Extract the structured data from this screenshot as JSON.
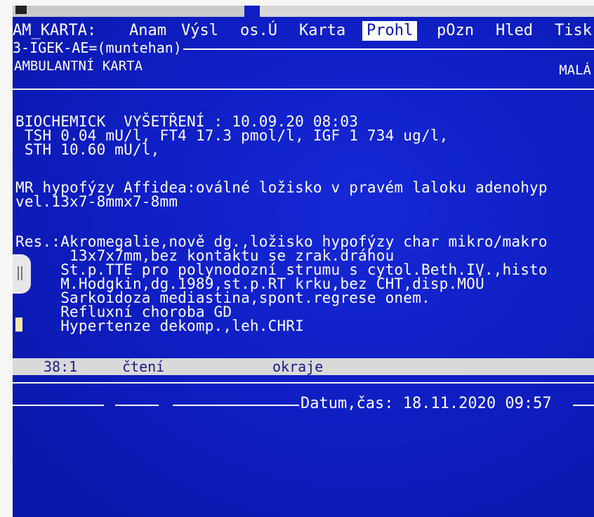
{
  "menu": {
    "app_label": "AM_KARTA:",
    "items": [
      {
        "label": "Anam"
      },
      {
        "label": "Výsl"
      },
      {
        "label": "os.Ú"
      },
      {
        "label": "Karta"
      },
      {
        "label": "Prohl",
        "active": true
      },
      {
        "label": "pOzn"
      },
      {
        "label": "Hled"
      },
      {
        "label": "Tisk"
      }
    ]
  },
  "patient_line": "3-IGEK-AE=(muntehan)",
  "header": {
    "title": "AMBULANTNÍ KARTA",
    "right_label": "MALÁ"
  },
  "content": {
    "lines": [
      "BIOCHEMICK  VYŠETŘENÍ : 10.09.20 08:03",
      " TSH 0.04 mU/l, FT4 17.3 pmol/l, IGF 1 734 ug/l,",
      " STH 10.60 mU/l,",
      "MR hypofýzy Affidea:oválné ložisko v pravém laloku adenohyp",
      "vel.13x7-8mmx7-8mm",
      "Res.:Akromegalie,nově dg.,ložisko hypofýzy char mikro/makro",
      "      13x7x7mm,bez kontaktu se zrak.dráhou",
      "     St.p.TTE pro polynodozní strumu s cytol.Beth.IV.,histo",
      "     M.Hodgkin,dg.1989,st.p.RT krku,bez CHT,disp.MOÚ",
      "     Sarkoidoza mediastina,spont.regrese onem.",
      "     Refluxní choroba GD",
      "     Hypertenze dekomp.,leh.CHRI"
    ]
  },
  "status": {
    "position": "38:1",
    "mode": "čtení",
    "edge": "okraje"
  },
  "footer": {
    "datetime_label": "Datum,čas: 18.11.2020 09:57"
  },
  "colors": {
    "screen_bg": "#0f1fc4",
    "text": "#ffffff",
    "status_bg": "#d9d9d9",
    "active_menu_bg": "#ffffff"
  }
}
